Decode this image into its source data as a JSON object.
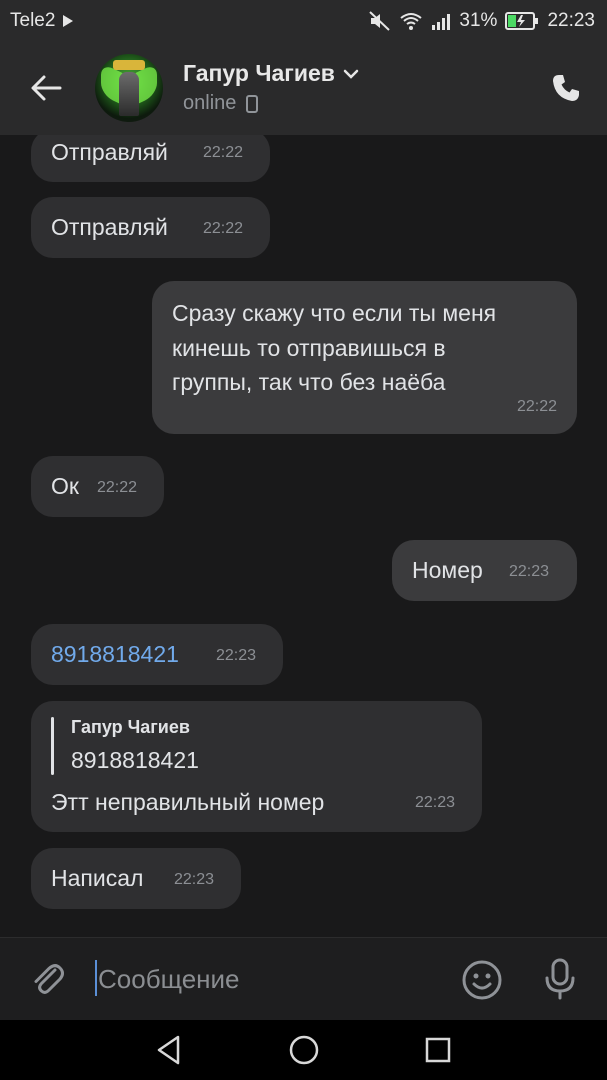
{
  "status_bar": {
    "carrier": "Tele2",
    "battery": "31%",
    "time": "22:23"
  },
  "header": {
    "contact_name": "Гапур Чагиев",
    "presence": "online"
  },
  "messages": [
    {
      "dir": "in",
      "text": "Отправляй",
      "time": "22:22"
    },
    {
      "dir": "in",
      "text": "Отправляй",
      "time": "22:22"
    },
    {
      "dir": "out",
      "lines": [
        "Сразу скажу что если ты меня",
        "кинешь то отправишься в",
        "группы, так что без наёба"
      ],
      "time": "22:22"
    },
    {
      "dir": "in",
      "text": "Ок",
      "time": "22:22"
    },
    {
      "dir": "out",
      "text": "Номер",
      "time": "22:23"
    },
    {
      "dir": "in",
      "text": "8918818421",
      "time": "22:23",
      "is_link": true
    },
    {
      "dir": "in",
      "reply_author": "Гапур Чагиев",
      "reply_text": "8918818421",
      "text": "Этт неправильный номер",
      "time": "22:23"
    },
    {
      "dir": "in",
      "text": "Написал",
      "time": "22:23"
    }
  ],
  "composer": {
    "placeholder": "Сообщение"
  },
  "icons": [
    "back-arrow-icon",
    "chevron-down-icon",
    "phone-icon",
    "attach-icon",
    "emoji-icon",
    "microphone-icon",
    "nav-back-icon",
    "nav-home-icon",
    "nav-recents-icon"
  ]
}
